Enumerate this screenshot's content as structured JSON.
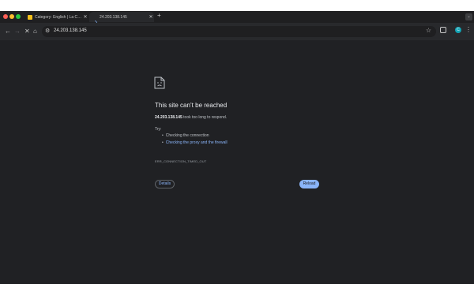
{
  "tabs": [
    {
      "title": "Category: English | La Commu",
      "favicon": "site-favicon",
      "active": false
    },
    {
      "title": "24.203.138.145",
      "favicon": "loading-spinner-icon",
      "active": true
    }
  ],
  "toolbar": {
    "url": "24.203.138.145",
    "profile_initial": "C"
  },
  "error": {
    "heading": "This site can’t be reached",
    "host": "24.203.138.145",
    "summary_suffix": " took too long to respond.",
    "try_label": "Try:",
    "suggestions": [
      "Checking the connection",
      "Checking the proxy and the firewall"
    ],
    "code": "ERR_CONNECTION_TIMED_OUT",
    "details_label": "Details",
    "reload_label": "Reload"
  },
  "colors": {
    "background": "#202124",
    "link": "#8ab4f8",
    "button_primary": "#8ab4f8"
  }
}
